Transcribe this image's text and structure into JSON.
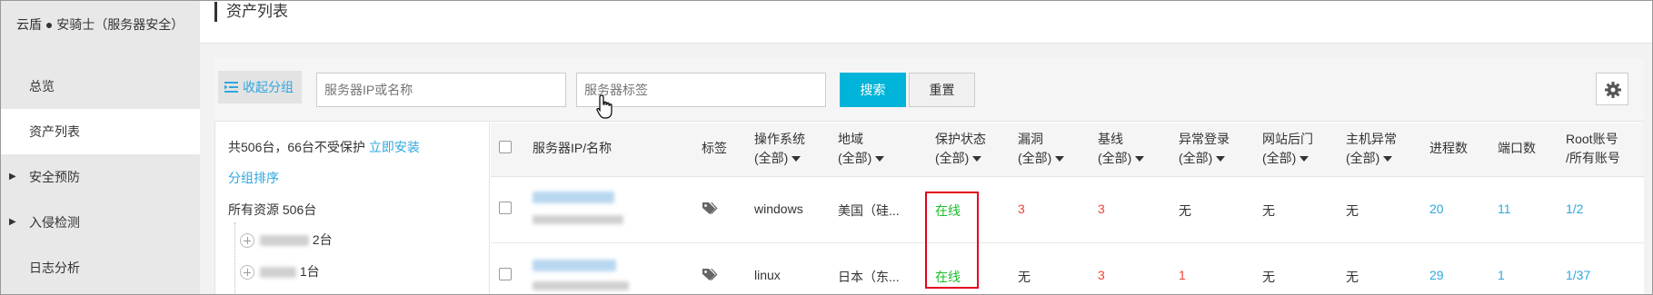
{
  "sidebar": {
    "brand": "云盾 ● 安骑士（服务器安全）",
    "items": [
      {
        "label": "总览"
      },
      {
        "label": "资产列表"
      },
      {
        "label": "安全预防"
      },
      {
        "label": "入侵检测"
      },
      {
        "label": "日志分析"
      }
    ]
  },
  "header": {
    "title": "资产列表"
  },
  "toolbar": {
    "collapse_label": "收起分组",
    "search_placeholder": "服务器IP或名称",
    "tag_placeholder": "服务器标签",
    "search_label": "搜索",
    "reset_label": "重置"
  },
  "groups": {
    "summary_prefix": "共506台，66台不受保护",
    "install_link": "立即安装",
    "sort_link": "分组排序",
    "all_resources": "所有资源 506台",
    "nodes": [
      {
        "count": "2台"
      },
      {
        "count": "1台"
      }
    ]
  },
  "table": {
    "columns": [
      {
        "label": "服务器IP/名称"
      },
      {
        "label": "标签"
      },
      {
        "label": "操作系统",
        "filter": "(全部)"
      },
      {
        "label": "地域",
        "filter": "(全部)"
      },
      {
        "label": "保护状态",
        "filter": "(全部)"
      },
      {
        "label": "漏洞",
        "filter": "(全部)"
      },
      {
        "label": "基线",
        "filter": "(全部)"
      },
      {
        "label": "异常登录",
        "filter": "(全部)"
      },
      {
        "label": "网站后门",
        "filter": "(全部)"
      },
      {
        "label": "主机异常",
        "filter": "(全部)"
      },
      {
        "label": "进程数"
      },
      {
        "label": "端口数"
      },
      {
        "label": "Root账号",
        "filter": "/所有账号"
      }
    ],
    "rows": [
      {
        "os": "windows",
        "region": "美国（硅...",
        "status": "在线",
        "vuln": "3",
        "baseline": "3",
        "abnormal_login": "无",
        "backdoor": "无",
        "host_abnormal": "无",
        "processes": "20",
        "ports": "11",
        "root": "1/2"
      },
      {
        "os": "linux",
        "region": "日本（东...",
        "status": "在线",
        "vuln": "无",
        "baseline": "3",
        "abnormal_login": "1",
        "backdoor": "无",
        "host_abnormal": "无",
        "processes": "29",
        "ports": "1",
        "root": "1/37"
      }
    ]
  },
  "colors": {
    "accent": "#00b4d9",
    "link": "#2ea7e0",
    "danger": "#f04134",
    "online": "#19be2a"
  }
}
